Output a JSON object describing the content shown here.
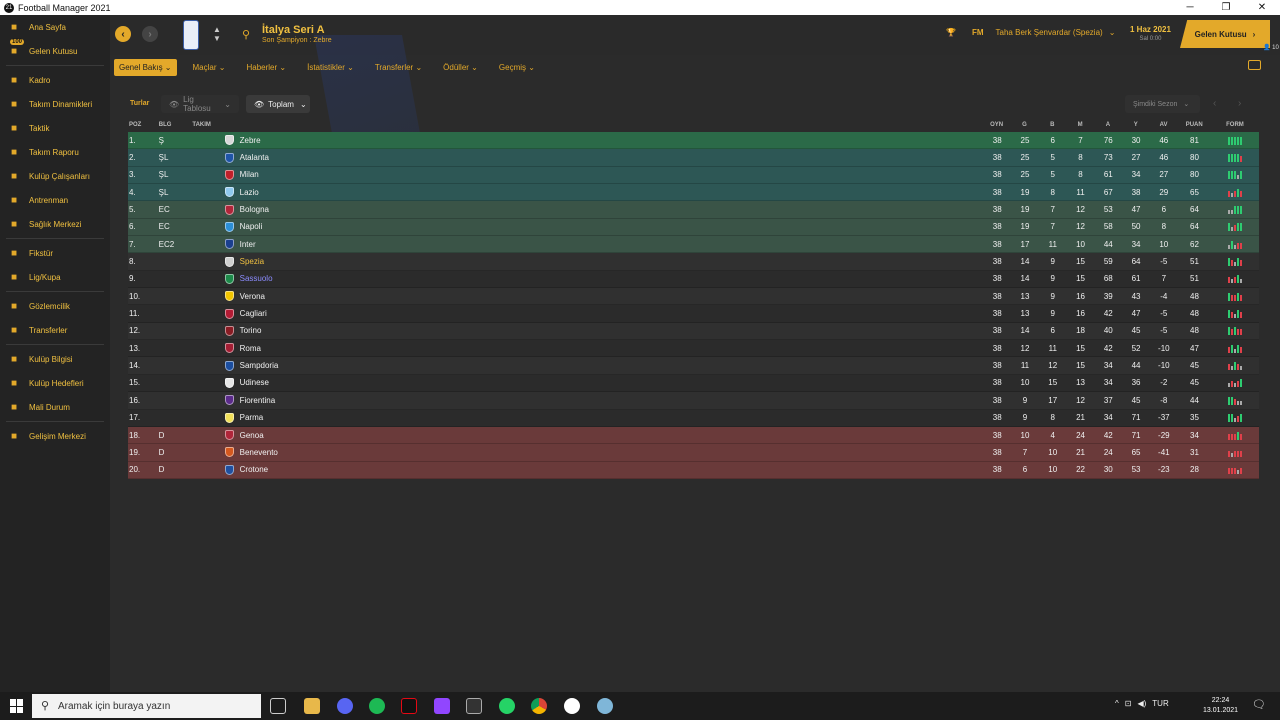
{
  "window": {
    "title": "Football Manager 2021"
  },
  "sidebar": {
    "items": [
      {
        "label": "Ana Sayfa",
        "icon": "home-icon"
      },
      {
        "label": "Gelen Kutusu",
        "icon": "inbox-icon",
        "badge": "100"
      },
      {
        "label": "Kadro",
        "icon": "shirt-icon"
      },
      {
        "label": "Takım Dinamikleri",
        "icon": "dynamics-icon"
      },
      {
        "label": "Taktik",
        "icon": "tactics-icon"
      },
      {
        "label": "Takım Raporu",
        "icon": "report-icon"
      },
      {
        "label": "Kulüp Çalışanları",
        "icon": "staff-icon"
      },
      {
        "label": "Antrenman",
        "icon": "training-icon"
      },
      {
        "label": "Sağlık Merkezi",
        "icon": "medical-icon"
      },
      {
        "label": "Fikstür",
        "icon": "fixtures-icon"
      },
      {
        "label": "Lig/Kupa",
        "icon": "trophy-icon"
      },
      {
        "label": "Gözlemcilik",
        "icon": "scouting-icon"
      },
      {
        "label": "Transferler",
        "icon": "transfers-icon"
      },
      {
        "label": "Kulüp Bilgisi",
        "icon": "club-info-icon"
      },
      {
        "label": "Kulüp Hedefleri",
        "icon": "club-vision-icon"
      },
      {
        "label": "Mali Durum",
        "icon": "finances-icon"
      },
      {
        "label": "Gelişim Merkezi",
        "icon": "development-icon"
      }
    ]
  },
  "header": {
    "league_title": "İtalya Seri A",
    "league_subtitle": "Son Şampiyon : Zebre",
    "manager_tag": "FM",
    "manager_name": "Taha Berk Şenvardar (Spezia)",
    "date": "1 Haz 2021",
    "time": "Sal 0:00",
    "inbox_button": "Gelen Kutusu",
    "inbox_count": "10"
  },
  "subnav": {
    "tabs": [
      "Genel Bakış",
      "Maçlar",
      "Haberler",
      "İstatistikler",
      "Transferler",
      "Ödüller",
      "Geçmiş"
    ]
  },
  "filters": {
    "label": "Turlar",
    "table_type": "Lig Tablosu",
    "view": "Toplam",
    "season": "Şimdiki Sezon"
  },
  "table": {
    "headers": {
      "pos": "POZ",
      "blg": "BLG",
      "team": "TAKIM",
      "oyn": "OYN",
      "g": "G",
      "b": "B",
      "m": "M",
      "a": "A",
      "y": "Y",
      "av": "AV",
      "puan": "PUAN",
      "form": "FORM"
    },
    "zone_colors": {
      "champion": "#2b6a48",
      "cl": "#2d5755",
      "el": "#3a5447",
      "normal_a": "#303030",
      "normal_b": "#2b2b2b",
      "relegation": "#6a3a3a"
    },
    "rows": [
      {
        "pos": "1.",
        "blg": "Ş",
        "team": "Zebre",
        "oyn": "38",
        "g": "25",
        "b": "6",
        "m": "7",
        "a": "76",
        "y": "30",
        "av": "46",
        "puan": "81",
        "zone": "champion",
        "crest": "#d8d8d8",
        "form": "WWWWW"
      },
      {
        "pos": "2.",
        "blg": "ŞL",
        "team": "Atalanta",
        "oyn": "38",
        "g": "25",
        "b": "5",
        "m": "8",
        "a": "73",
        "y": "27",
        "av": "46",
        "puan": "80",
        "zone": "cl",
        "crest": "#1f55a8",
        "form": "WWWWL"
      },
      {
        "pos": "3.",
        "blg": "ŞL",
        "team": "Milan",
        "oyn": "38",
        "g": "25",
        "b": "5",
        "m": "8",
        "a": "61",
        "y": "34",
        "av": "27",
        "puan": "80",
        "zone": "cl",
        "crest": "#c0202a",
        "form": "WWWDW"
      },
      {
        "pos": "4.",
        "blg": "ŞL",
        "team": "Lazio",
        "oyn": "38",
        "g": "19",
        "b": "8",
        "m": "11",
        "a": "67",
        "y": "38",
        "av": "29",
        "puan": "65",
        "zone": "cl",
        "crest": "#8fc9ef",
        "form": "LDLWL"
      },
      {
        "pos": "5.",
        "blg": "EC",
        "team": "Bologna",
        "oyn": "38",
        "g": "19",
        "b": "7",
        "m": "12",
        "a": "53",
        "y": "47",
        "av": "6",
        "puan": "64",
        "zone": "el",
        "crest": "#b0263a",
        "form": "DDWWW"
      },
      {
        "pos": "6.",
        "blg": "EC",
        "team": "Napoli",
        "oyn": "38",
        "g": "19",
        "b": "7",
        "m": "12",
        "a": "58",
        "y": "50",
        "av": "8",
        "puan": "64",
        "zone": "el",
        "crest": "#2c8fd6",
        "form": "WDLWW"
      },
      {
        "pos": "7.",
        "blg": "EC2",
        "team": "Inter",
        "oyn": "38",
        "g": "17",
        "b": "11",
        "m": "10",
        "a": "44",
        "y": "34",
        "av": "10",
        "puan": "62",
        "zone": "el",
        "crest": "#1b3f8f",
        "form": "DWDLL"
      },
      {
        "pos": "8.",
        "blg": "",
        "team": "Spezia",
        "oyn": "38",
        "g": "14",
        "b": "9",
        "m": "15",
        "a": "59",
        "y": "64",
        "av": "-5",
        "puan": "51",
        "zone": "normal_a",
        "crest": "#cfcfcf",
        "form": "WLDWL",
        "highlight": "#f0c040"
      },
      {
        "pos": "9.",
        "blg": "",
        "team": "Sassuolo",
        "oyn": "38",
        "g": "14",
        "b": "9",
        "m": "15",
        "a": "68",
        "y": "61",
        "av": "7",
        "puan": "51",
        "zone": "normal_b",
        "crest": "#1d8a4a",
        "form": "LDLWD",
        "highlight": "#8c8cff"
      },
      {
        "pos": "10.",
        "blg": "",
        "team": "Verona",
        "oyn": "38",
        "g": "13",
        "b": "9",
        "m": "16",
        "a": "39",
        "y": "43",
        "av": "-4",
        "puan": "48",
        "zone": "normal_a",
        "crest": "#f2c500",
        "form": "WLLWL"
      },
      {
        "pos": "11.",
        "blg": "",
        "team": "Cagliari",
        "oyn": "38",
        "g": "13",
        "b": "9",
        "m": "16",
        "a": "42",
        "y": "47",
        "av": "-5",
        "puan": "48",
        "zone": "normal_b",
        "crest": "#b31b34",
        "form": "WLDWL"
      },
      {
        "pos": "12.",
        "blg": "",
        "team": "Torino",
        "oyn": "38",
        "g": "14",
        "b": "6",
        "m": "18",
        "a": "40",
        "y": "45",
        "av": "-5",
        "puan": "48",
        "zone": "normal_a",
        "crest": "#8a1c24",
        "form": "WLWLL"
      },
      {
        "pos": "13.",
        "blg": "",
        "team": "Roma",
        "oyn": "38",
        "g": "12",
        "b": "11",
        "m": "15",
        "a": "42",
        "y": "52",
        "av": "-10",
        "puan": "47",
        "zone": "normal_b",
        "crest": "#a41e34",
        "form": "LWDWL"
      },
      {
        "pos": "14.",
        "blg": "",
        "team": "Sampdoria",
        "oyn": "38",
        "g": "11",
        "b": "12",
        "m": "15",
        "a": "34",
        "y": "44",
        "av": "-10",
        "puan": "45",
        "zone": "normal_a",
        "crest": "#1b4ea0",
        "form": "LDWLD"
      },
      {
        "pos": "15.",
        "blg": "",
        "team": "Udinese",
        "oyn": "38",
        "g": "10",
        "b": "15",
        "m": "13",
        "a": "34",
        "y": "36",
        "av": "-2",
        "puan": "45",
        "zone": "normal_b",
        "crest": "#e6e6e6",
        "form": "DLDLW"
      },
      {
        "pos": "16.",
        "blg": "",
        "team": "Fiorentina",
        "oyn": "38",
        "g": "9",
        "b": "17",
        "m": "12",
        "a": "37",
        "y": "45",
        "av": "-8",
        "puan": "44",
        "zone": "normal_a",
        "crest": "#5b2b8a",
        "form": "WWLDD"
      },
      {
        "pos": "17.",
        "blg": "",
        "team": "Parma",
        "oyn": "38",
        "g": "9",
        "b": "8",
        "m": "21",
        "a": "34",
        "y": "71",
        "av": "-37",
        "puan": "35",
        "zone": "normal_b",
        "crest": "#f1e05a",
        "form": "WWDLW"
      },
      {
        "pos": "18.",
        "blg": "D",
        "team": "Genoa",
        "oyn": "38",
        "g": "10",
        "b": "4",
        "m": "24",
        "a": "42",
        "y": "71",
        "av": "-29",
        "puan": "34",
        "zone": "relegation",
        "crest": "#b0263a",
        "form": "LLLWL"
      },
      {
        "pos": "19.",
        "blg": "D",
        "team": "Benevento",
        "oyn": "38",
        "g": "7",
        "b": "10",
        "m": "21",
        "a": "24",
        "y": "65",
        "av": "-41",
        "puan": "31",
        "zone": "relegation",
        "crest": "#d4581e",
        "form": "LDLLL"
      },
      {
        "pos": "20.",
        "blg": "D",
        "team": "Crotone",
        "oyn": "38",
        "g": "6",
        "b": "10",
        "m": "22",
        "a": "30",
        "y": "53",
        "av": "-23",
        "puan": "28",
        "zone": "relegation",
        "crest": "#2050a0",
        "form": "LLLDL"
      }
    ]
  },
  "taskbar": {
    "search_placeholder": "Aramak için buraya yazın",
    "lang": "TUR",
    "time": "22:24",
    "date": "13.01.2021",
    "notif_count": "3",
    "form_colors": {
      "W": "#2ecc71",
      "D": "#aaaaaa",
      "L": "#e0404a"
    }
  }
}
